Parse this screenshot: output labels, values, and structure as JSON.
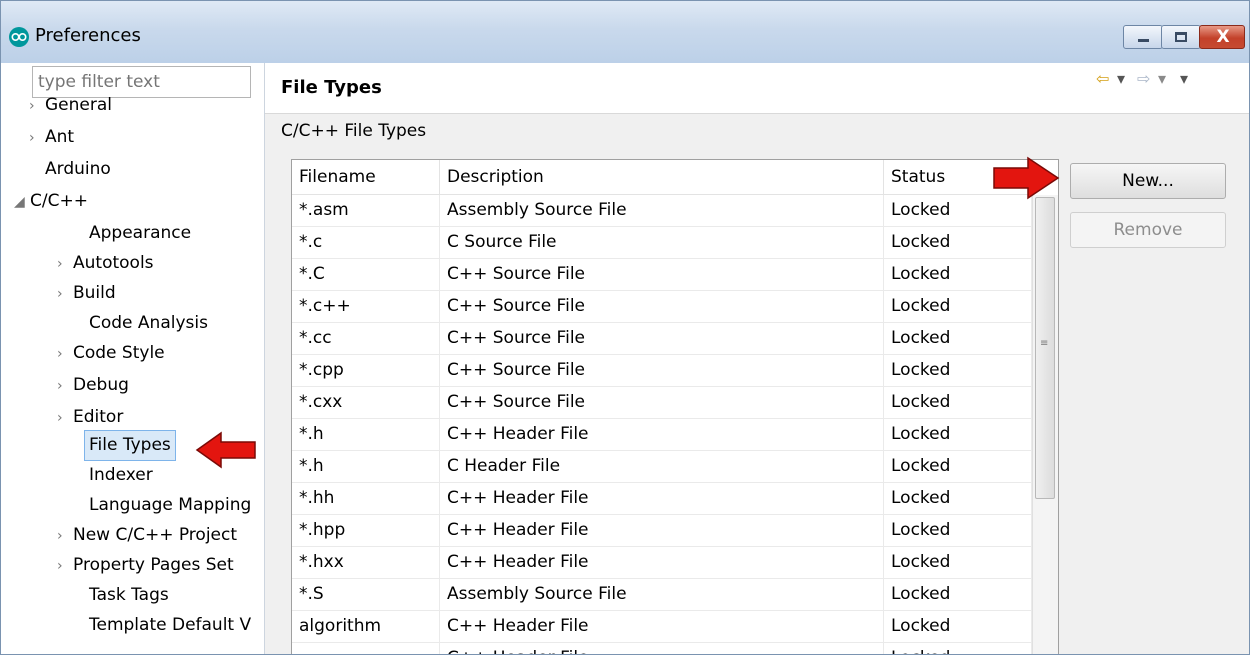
{
  "window": {
    "title": "Preferences"
  },
  "window_controls": {
    "minimize": "minimize",
    "maximize": "maximize",
    "close": "X"
  },
  "filter": {
    "placeholder": "type filter text"
  },
  "tree": [
    {
      "label": "General",
      "arrow": "›"
    },
    {
      "label": "Ant",
      "arrow": "›"
    },
    {
      "label": "Arduino",
      "arrow": ""
    },
    {
      "label": "C/C++",
      "arrow": "◢"
    },
    {
      "label": "Appearance",
      "arrow": ""
    },
    {
      "label": "Autotools",
      "arrow": "›"
    },
    {
      "label": "Build",
      "arrow": "›"
    },
    {
      "label": "Code Analysis",
      "arrow": ""
    },
    {
      "label": "Code Style",
      "arrow": "›"
    },
    {
      "label": "Debug",
      "arrow": "›"
    },
    {
      "label": "Editor",
      "arrow": "›"
    },
    {
      "label": "File Types",
      "arrow": ""
    },
    {
      "label": "Indexer",
      "arrow": ""
    },
    {
      "label": "Language Mapping",
      "arrow": ""
    },
    {
      "label": "New C/C++ Project",
      "arrow": "›"
    },
    {
      "label": "Property Pages Set",
      "arrow": "›"
    },
    {
      "label": "Task Tags",
      "arrow": ""
    },
    {
      "label": "Template Default V",
      "arrow": ""
    }
  ],
  "page": {
    "title": "File Types",
    "section_label": "C/C++ File Types"
  },
  "nav": {
    "back": "⇦",
    "dropdown": "▾",
    "forward": "⇨",
    "menu": "▾"
  },
  "table": {
    "columns": [
      "Filename",
      "Description",
      "Status"
    ],
    "rows": [
      [
        "*.asm",
        "Assembly Source File",
        "Locked"
      ],
      [
        "*.c",
        "C Source File",
        "Locked"
      ],
      [
        "*.C",
        "C++ Source File",
        "Locked"
      ],
      [
        "*.c++",
        "C++ Source File",
        "Locked"
      ],
      [
        "*.cc",
        "C++ Source File",
        "Locked"
      ],
      [
        "*.cpp",
        "C++ Source File",
        "Locked"
      ],
      [
        "*.cxx",
        "C++ Source File",
        "Locked"
      ],
      [
        "*.h",
        "C++ Header File",
        "Locked"
      ],
      [
        "*.h",
        "C Header File",
        "Locked"
      ],
      [
        "*.hh",
        "C++ Header File",
        "Locked"
      ],
      [
        "*.hpp",
        "C++ Header File",
        "Locked"
      ],
      [
        "*.hxx",
        "C++ Header File",
        "Locked"
      ],
      [
        "*.S",
        "Assembly Source File",
        "Locked"
      ],
      [
        "algorithm",
        "C++ Header File",
        "Locked"
      ],
      [
        "",
        "C++ Header File",
        "Locked"
      ]
    ]
  },
  "buttons": {
    "new": "New...",
    "remove": "Remove"
  },
  "colors": {
    "accent_arrow": "#e3150f",
    "selection": "#d9e9f8",
    "titlebar": "#c9d9ec"
  }
}
